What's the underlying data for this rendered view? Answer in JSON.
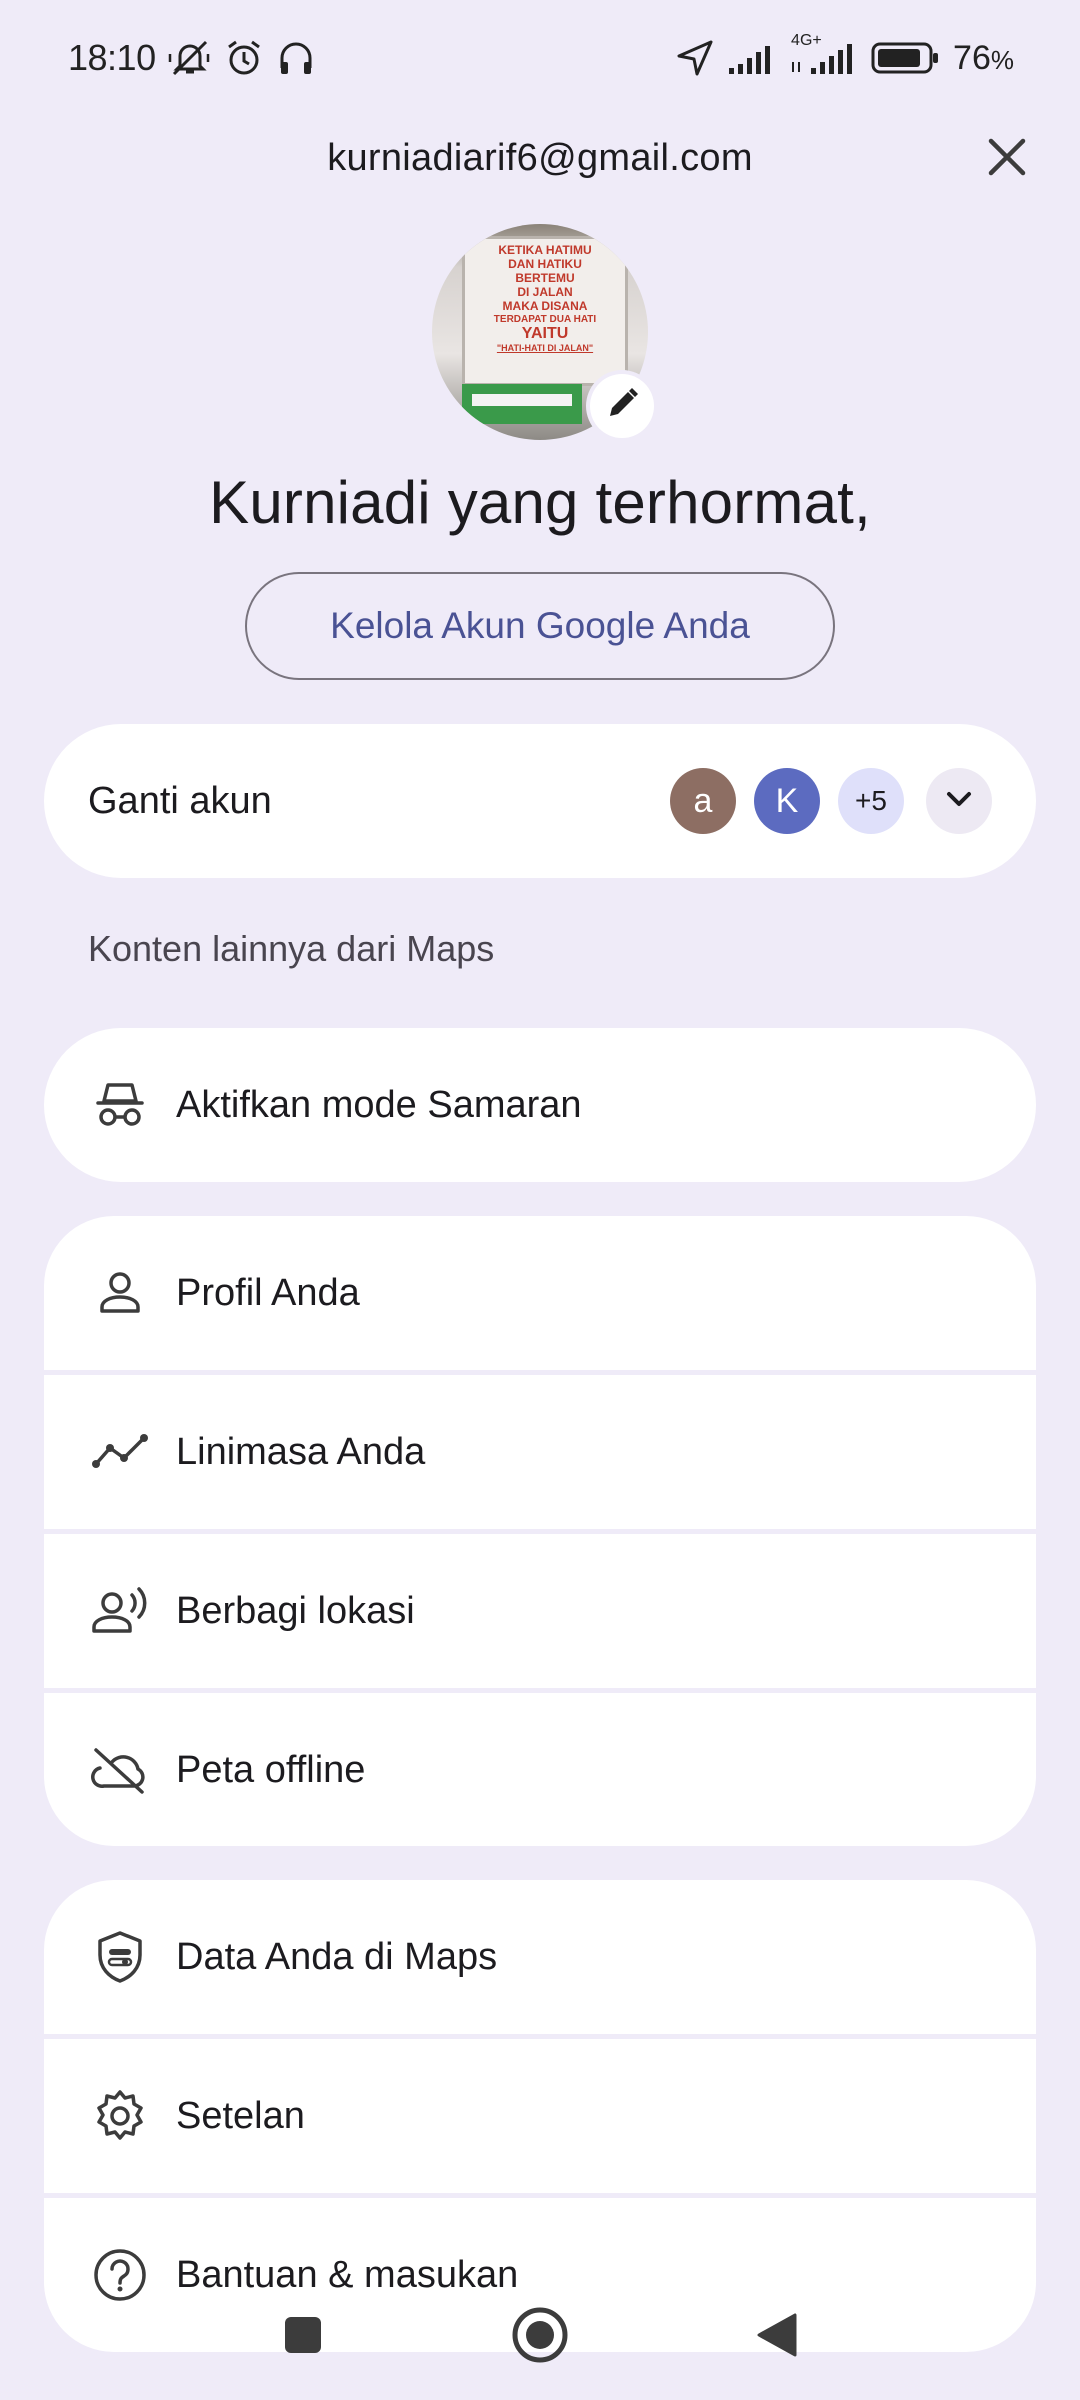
{
  "status_bar": {
    "time": "18:10",
    "battery_pct": "76",
    "battery_unit": "%",
    "network_label": "4G+",
    "icons": [
      "mute-icon",
      "alarm-icon",
      "headphones-icon",
      "location-arrow-icon",
      "signal-icon",
      "signal-4g-icon",
      "battery-icon"
    ]
  },
  "header": {
    "email": "kurniadiarif6@gmail.com",
    "close_icon": "close-icon"
  },
  "profile": {
    "avatar_caption_lines": [
      "KETIKA HATIMU",
      "DAN HATIKU",
      "BERTEMU",
      "DI JALAN",
      "MAKA DISANA",
      "TERDAPAT DUA HATI",
      "YAITU",
      "\"HATI-HATI DI JALAN\""
    ],
    "edit_icon": "pencil-icon",
    "greeting": "Kurniadi yang terhormat,",
    "manage_button": "Kelola Akun Google Anda"
  },
  "switch_account": {
    "label": "Ganti akun",
    "accounts": [
      {
        "initial": "a",
        "color": "#8d6e63"
      },
      {
        "initial": "K",
        "color": "#5c6bc0"
      }
    ],
    "more_count": "+5",
    "expand_icon": "chevron-down-icon"
  },
  "section_label": "Konten lainnya dari Maps",
  "menu": {
    "incognito": {
      "label": "Aktifkan mode Samaran",
      "icon": "incognito-icon"
    },
    "group1": [
      {
        "label": "Profil Anda",
        "icon": "person-icon"
      },
      {
        "label": "Linimasa Anda",
        "icon": "timeline-icon"
      },
      {
        "label": "Berbagi lokasi",
        "icon": "location-sharing-icon"
      },
      {
        "label": "Peta offline",
        "icon": "cloud-off-icon"
      }
    ],
    "group2": [
      {
        "label": "Data Anda di Maps",
        "icon": "shield-icon"
      },
      {
        "label": "Setelan",
        "icon": "gear-icon"
      },
      {
        "label": "Bantuan & masukan",
        "icon": "help-icon"
      }
    ]
  },
  "nav": {
    "recents_icon": "square-icon",
    "home_icon": "circle-home-icon",
    "back_icon": "triangle-back-icon"
  },
  "colors": {
    "background": "#efebf8",
    "card": "#ffffff",
    "accent_text": "#4a5294",
    "more_badge": "#dfe0fa"
  }
}
